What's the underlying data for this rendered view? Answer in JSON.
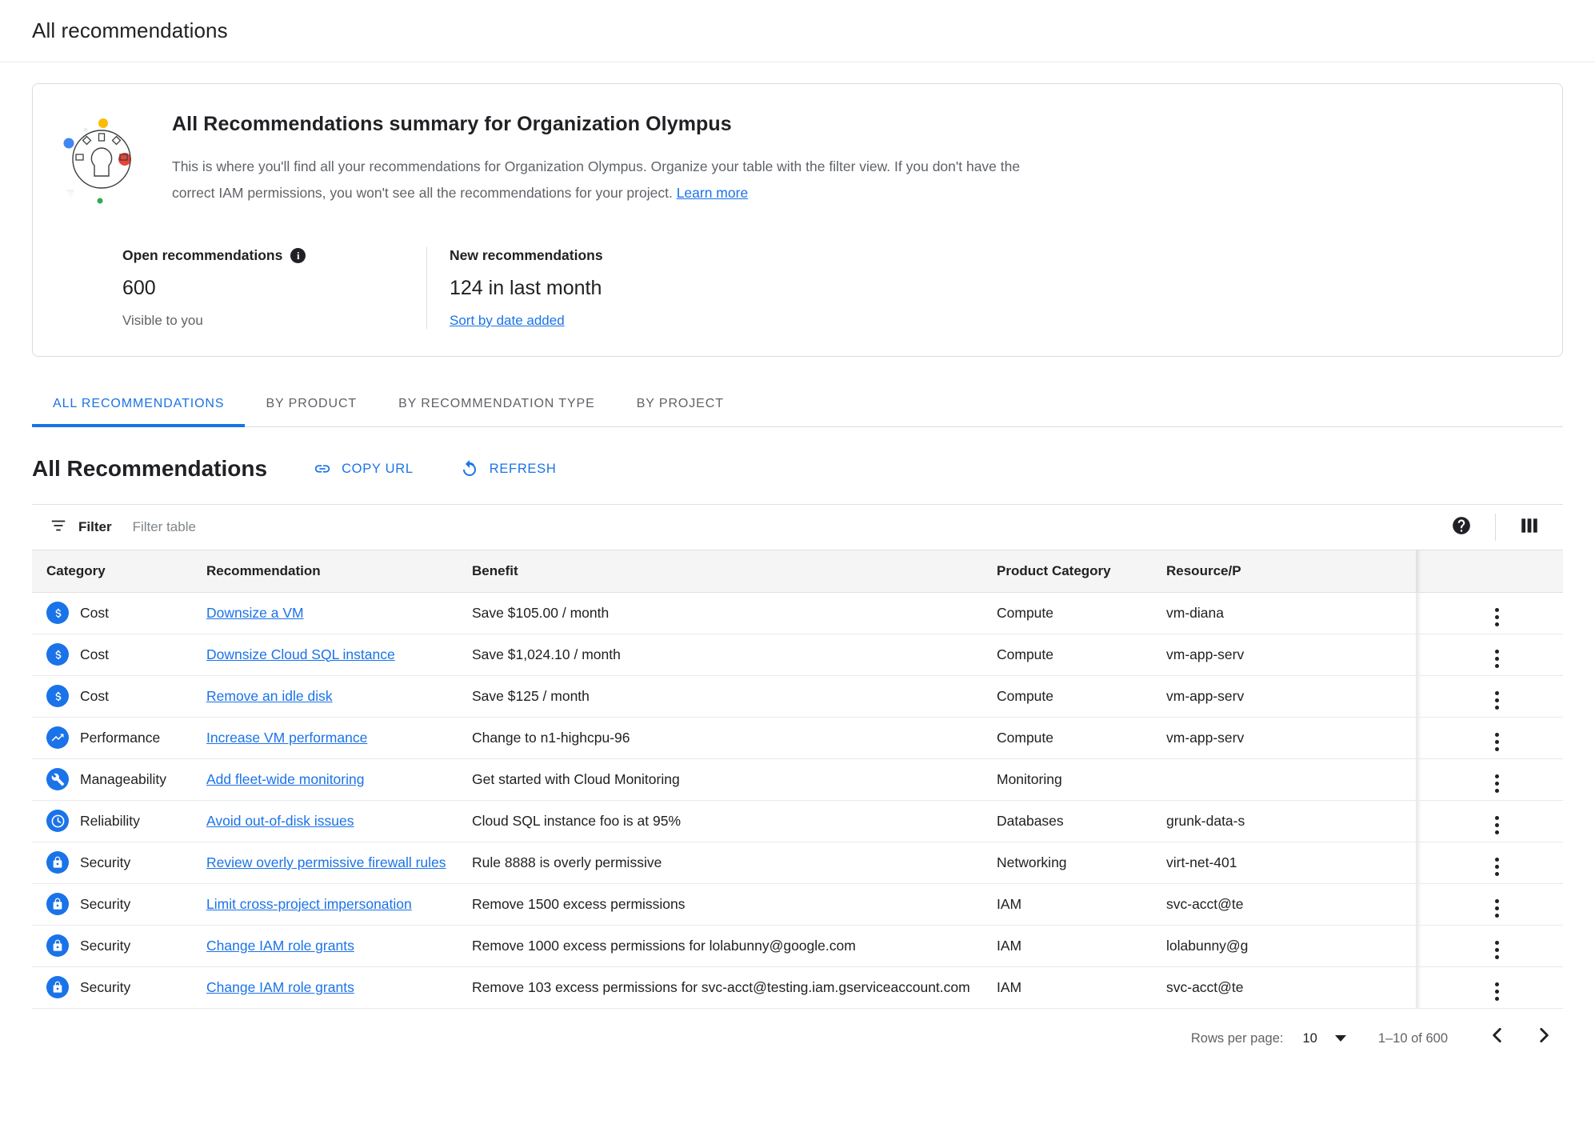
{
  "topbar": {
    "title": "All recommendations"
  },
  "summary_card": {
    "heading": "All Recommendations summary for Organization Olympus",
    "description_part1": "This is where you'll find all your recommendations for Organization Olympus. Organize your table with the filter view. If you don't have the correct IAM permissions, you won't see all the recommendations for your project. ",
    "learn_more": "Learn more",
    "open": {
      "label": "Open recommendations",
      "value": "600",
      "sub": "Visible to you"
    },
    "new": {
      "label": "New recommendations",
      "value": "124 in last month",
      "link": "Sort by date added"
    }
  },
  "tabs": [
    {
      "label": "ALL RECOMMENDATIONS",
      "active": true
    },
    {
      "label": "BY PRODUCT",
      "active": false
    },
    {
      "label": "BY RECOMMENDATION TYPE",
      "active": false
    },
    {
      "label": "BY PROJECT",
      "active": false
    }
  ],
  "table_toolbar": {
    "title": "All Recommendations",
    "copy_url": "COPY URL",
    "refresh": "REFRESH"
  },
  "filter_bar": {
    "filter_label": "Filter",
    "filter_placeholder": "Filter table",
    "filter_value": ""
  },
  "table": {
    "columns": [
      "Category",
      "Recommendation",
      "Benefit",
      "Product Category",
      "Resource/P"
    ],
    "rows": [
      {
        "category": "Cost",
        "icon": "dollar-icon",
        "recommendation": "Downsize a VM",
        "benefit": "Save $105.00 / month",
        "product_category": "Compute",
        "resource": "vm-diana"
      },
      {
        "category": "Cost",
        "icon": "dollar-icon",
        "recommendation": "Downsize Cloud SQL instance",
        "benefit": "Save $1,024.10 / month",
        "product_category": "Compute",
        "resource": "vm-app-serv"
      },
      {
        "category": "Cost",
        "icon": "dollar-icon",
        "recommendation": "Remove an idle disk",
        "benefit": "Save $125 / month",
        "product_category": "Compute",
        "resource": "vm-app-serv"
      },
      {
        "category": "Performance",
        "icon": "trending-up-icon",
        "recommendation": "Increase VM performance",
        "benefit": "Change to n1-highcpu-96",
        "product_category": "Compute",
        "resource": "vm-app-serv"
      },
      {
        "category": "Manageability",
        "icon": "wrench-icon",
        "recommendation": "Add fleet-wide monitoring",
        "benefit": "Get started with Cloud Monitoring",
        "product_category": "Monitoring",
        "resource": ""
      },
      {
        "category": "Reliability",
        "icon": "clock-icon",
        "recommendation": "Avoid out-of-disk issues",
        "benefit": "Cloud SQL instance foo is at 95%",
        "product_category": "Databases",
        "resource": "grunk-data-s"
      },
      {
        "category": "Security",
        "icon": "lock-icon",
        "recommendation": "Review overly permissive firewall rules",
        "benefit": "Rule 8888 is overly permissive",
        "product_category": "Networking",
        "resource": "virt-net-401"
      },
      {
        "category": "Security",
        "icon": "lock-icon",
        "recommendation": "Limit cross-project impersonation",
        "benefit": "Remove 1500 excess permissions",
        "product_category": "IAM",
        "resource": "svc-acct@te"
      },
      {
        "category": "Security",
        "icon": "lock-icon",
        "recommendation": "Change IAM role grants",
        "benefit": "Remove 1000 excess permissions for lolabunny@google.com",
        "product_category": "IAM",
        "resource": "lolabunny@g"
      },
      {
        "category": "Security",
        "icon": "lock-icon",
        "recommendation": "Change IAM role grants",
        "benefit": "Remove 103 excess permissions for svc-acct@testing.iam.gserviceaccount.com",
        "product_category": "IAM",
        "resource": "svc-acct@te"
      }
    ]
  },
  "footer": {
    "rows_per_page_label": "Rows per page:",
    "rows_per_page_value": "10",
    "range": "1–10 of 600"
  },
  "colors": {
    "accent": "#1a73e8",
    "text_primary": "#202124",
    "text_secondary": "#5f6368",
    "header_bg": "#f5f5f5",
    "border": "#dadce0",
    "illus_yellow": "#fbbc04",
    "illus_blue": "#4285f4",
    "illus_red": "#ea4335",
    "illus_green": "#34a853"
  }
}
